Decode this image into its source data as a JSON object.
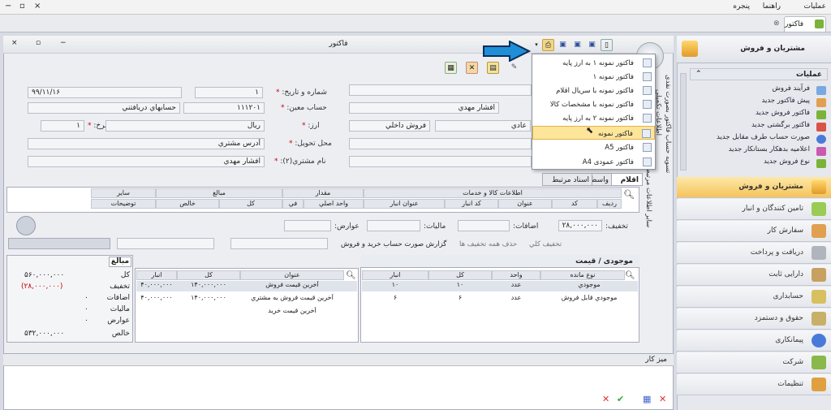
{
  "menubar": {
    "items": [
      "عمليات",
      "راهنما",
      "پنجره"
    ]
  },
  "doc_tab": "فاکتور",
  "window": {
    "title": "فاکتور"
  },
  "toolbar": {
    "print_tooltip": "چاپ"
  },
  "print_menu": {
    "items": [
      "فاکتور نمونه ۱ به ارز پايه",
      "فاکتور نمونه ۱",
      "فاکتور نمونه با سريال اقلام",
      "فاکتور نمونه با مشخصات کالا",
      "فاکتور نمونه ۲ به ارز پايه",
      "فاکتور نمونه",
      "فاکتور A5",
      "فاکتور عمودی A4"
    ],
    "highlighted_index": 5
  },
  "form": {
    "date_label": "شماره و تاريخ:",
    "number": "۱",
    "date": "۹۹/۱۱/۱۶",
    "account_label": "حساب معين:",
    "account_code": "۱۱۱۲۰۱",
    "account_name": "حسابهاي دريافتني",
    "customer_name": "افشار مهدي",
    "currency_label": "ارز:",
    "currency": "ريال",
    "rate_label": "نرخ:",
    "rate": "۱",
    "sale_type": "عادي",
    "sale_kind": "فروش داخلي",
    "delivery_label": "محل تحويل:",
    "delivery": "آدرس مشتري",
    "customer2_label": "نام مشتري(۲):",
    "customer2": "افشار مهدي"
  },
  "tabs": {
    "items": "اقلام",
    "agent": "واسط",
    "docs": "اسناد مرتبط"
  },
  "items_grid": {
    "groups": {
      "goods": "اطلاعات کالا و خدمات",
      "qty": "مقدار",
      "amounts": "مبالغ",
      "other": "ساير"
    },
    "columns": [
      "رديف",
      "کد",
      "عنوان",
      "کد انبار",
      "عنوان انبار",
      "واحد اصلي",
      "في",
      "کل",
      "خالص",
      "توضيحات"
    ]
  },
  "totals_row": {
    "discount_label": "تخفيف:",
    "discount": "۲۸,۰۰۰,۰۰۰",
    "additions_label": "اضافات:",
    "tax_label": "ماليات:",
    "duties_label": "عوارض:"
  },
  "actions": {
    "discount_all": "تخفيف کلي",
    "delete_discounts": "حذف همه تخفيف ها",
    "report": "گزارش صورت حساب خريد و فروش"
  },
  "stock_panel": {
    "title": "موجودی / قيمت",
    "columns": [
      "نوع مانده",
      "واحد",
      "کل",
      "انبار"
    ],
    "rows": [
      [
        "موجودي",
        "عدد",
        "۱۰",
        "۱۰"
      ],
      [
        "موجودي قابل فروش",
        "عدد",
        "۶",
        "۶"
      ]
    ]
  },
  "price_panel": {
    "columns": [
      "عنوان",
      "کل",
      "انبار"
    ],
    "rows": [
      [
        "آخرين قيمت فروش",
        "۱۴۰,۰۰۰,۰۰۰",
        "۴۰,۰۰۰,۰۰۰"
      ],
      [
        "آخرين قيمت فروش به مشتري",
        "۱۴۰,۰۰۰,۰۰۰",
        "۴۰,۰۰۰,۰۰۰"
      ],
      [
        "آخرين قيمت خريد",
        "",
        ""
      ]
    ]
  },
  "summary": {
    "header": "مبالغ",
    "rows": [
      {
        "label": "کل",
        "value": "۵۶۰,۰۰۰,۰۰۰"
      },
      {
        "label": "تخفيف",
        "value": "(۲۸,۰۰۰,۰۰۰)"
      },
      {
        "label": "اضافات",
        "value": "۰"
      },
      {
        "label": "ماليات",
        "value": "۰"
      },
      {
        "label": "عوارض",
        "value": "۰"
      },
      {
        "label": "خالص",
        "value": "۵۳۲,۰۰۰,۰۰۰"
      }
    ]
  },
  "vertical_tabs": [
    "تسويه حساب فاکتور بصورت نقدی",
    "اطلاعات تکميلی",
    "ساير اطلاعات مرتبط"
  ],
  "desk": {
    "title": "ميز کار"
  },
  "right_panel": {
    "title": "مشتريان و فروش",
    "ops_title": "عمليات",
    "ops": [
      "فرآيند فروش",
      "پيش فاکتور جديد",
      "فاکتور فروش جديد",
      "فاکتور برگشتی جديد",
      "صورت حساب طرف مقابل جديد",
      "اعلاميه بدهکار بستانکار جديد",
      "نوع فروش جديد"
    ],
    "nav": [
      "مشتريان و فروش",
      "تامين کنندگان و انبار",
      "سفارش کار",
      "دريافت و پرداخت",
      "دارايی ثابت",
      "حسابداری",
      "حقوق و دستمزد",
      "پيمانکاری",
      "شرکت",
      "تنظيمات"
    ]
  },
  "colors": {
    "arrow": "#1e8fd6",
    "menu_highlight": "#fde59a",
    "nav_active": "#f6c35a"
  }
}
